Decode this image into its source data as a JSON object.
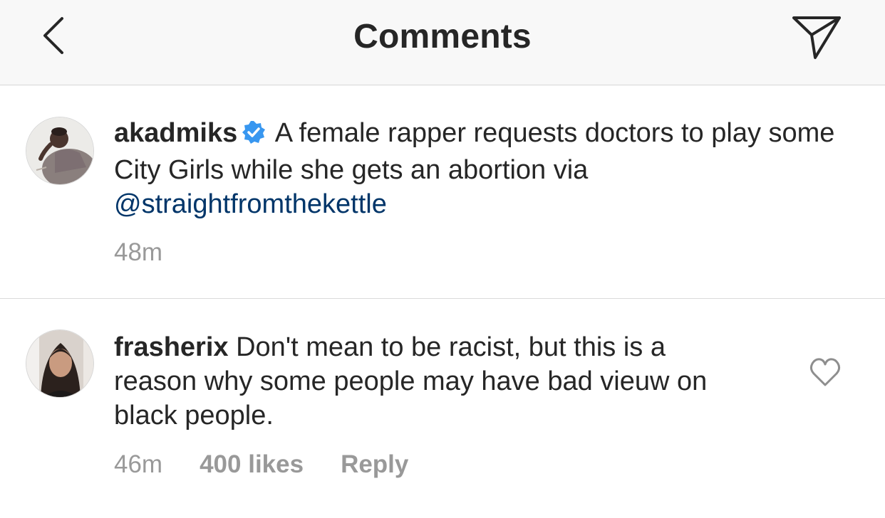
{
  "header": {
    "title": "Comments",
    "back_icon": "chevron-left-icon",
    "share_icon": "paper-plane-icon"
  },
  "caption": {
    "username": "akadmiks",
    "verified": true,
    "text": "A female rapper requests doctors to play some City Girls while she gets an abortion via",
    "mention": "@straightfromthekettle",
    "time": "48m"
  },
  "comment": {
    "username": "frasherix",
    "text": "Don't mean to be racist, but this is a reason why some people may have bad vieuw on black people.",
    "time": "46m",
    "likes": "400 likes",
    "reply": "Reply",
    "heart_icon": "heart-outline-icon"
  },
  "colors": {
    "header_bg": "#f8f8f8",
    "text": "#262626",
    "meta": "#999999",
    "mention": "#003569",
    "verified": "#3897f0"
  }
}
